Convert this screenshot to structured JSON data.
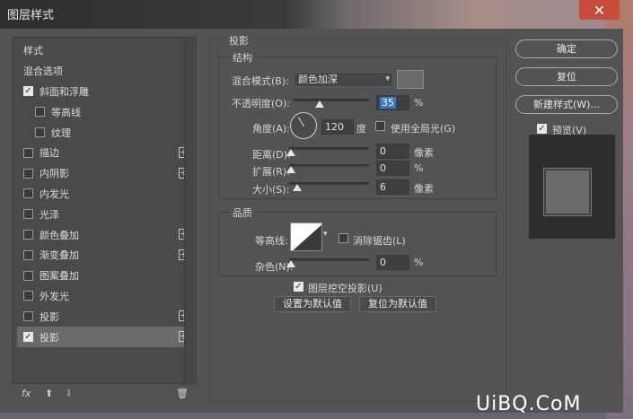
{
  "window": {
    "title": "图层样式"
  },
  "left_panel": {
    "items": [
      {
        "label": "样式",
        "checkbox": false,
        "checked": false,
        "plus": false,
        "sub": false,
        "selected": false
      },
      {
        "label": "混合选项",
        "checkbox": false,
        "checked": false,
        "plus": false,
        "sub": false,
        "selected": false
      },
      {
        "label": "斜面和浮雕",
        "checkbox": true,
        "checked": true,
        "plus": false,
        "sub": false,
        "selected": false
      },
      {
        "label": "等高线",
        "checkbox": true,
        "checked": false,
        "plus": false,
        "sub": true,
        "selected": false
      },
      {
        "label": "纹理",
        "checkbox": true,
        "checked": false,
        "plus": false,
        "sub": true,
        "selected": false
      },
      {
        "label": "描边",
        "checkbox": true,
        "checked": false,
        "plus": true,
        "sub": false,
        "selected": false
      },
      {
        "label": "内阴影",
        "checkbox": true,
        "checked": false,
        "plus": true,
        "sub": false,
        "selected": false
      },
      {
        "label": "内发光",
        "checkbox": true,
        "checked": false,
        "plus": false,
        "sub": false,
        "selected": false
      },
      {
        "label": "光泽",
        "checkbox": true,
        "checked": false,
        "plus": false,
        "sub": false,
        "selected": false
      },
      {
        "label": "颜色叠加",
        "checkbox": true,
        "checked": false,
        "plus": true,
        "sub": false,
        "selected": false
      },
      {
        "label": "渐变叠加",
        "checkbox": true,
        "checked": false,
        "plus": true,
        "sub": false,
        "selected": false
      },
      {
        "label": "图案叠加",
        "checkbox": true,
        "checked": false,
        "plus": false,
        "sub": false,
        "selected": false
      },
      {
        "label": "外发光",
        "checkbox": true,
        "checked": false,
        "plus": false,
        "sub": false,
        "selected": false
      },
      {
        "label": "投影",
        "checkbox": true,
        "checked": false,
        "plus": true,
        "sub": false,
        "selected": false
      },
      {
        "label": "投影",
        "checkbox": true,
        "checked": true,
        "plus": true,
        "sub": false,
        "selected": true
      }
    ],
    "bottom": {
      "fx": "fx",
      "up": "⬆",
      "down": "⬇",
      "trash": "🗑"
    }
  },
  "shadow": {
    "section_title": "投影",
    "structure_title": "结构",
    "blend_mode_label": "混合模式(B):",
    "blend_mode_value": "颜色加深",
    "opacity_label": "不透明度(O):",
    "opacity_value": "35",
    "opacity_unit": "%",
    "opacity_level": 0.35,
    "angle_label": "角度(A):",
    "angle_value": "120",
    "angle_unit": "度",
    "global_light_label": "使用全局光(G)",
    "global_light_checked": false,
    "distance_label": "距离(D):",
    "distance_value": "0",
    "distance_unit": "像素",
    "spread_label": "扩展(R):",
    "spread_value": "0",
    "spread_unit": "%",
    "size_label": "大小(S):",
    "size_value": "6",
    "size_unit": "像素",
    "quality_title": "品质",
    "contour_label": "等高线:",
    "antialias_label": "消除锯齿(L)",
    "antialias_checked": false,
    "noise_label": "杂色(N):",
    "noise_value": "0",
    "noise_unit": "%",
    "knockout_label": "图层挖空投影(U)",
    "knockout_checked": true,
    "set_default_label": "设置为默认值",
    "reset_default_label": "复位为默认值"
  },
  "right": {
    "ok_label": "确定",
    "reset_label": "复位",
    "new_style_label": "新建样式(W)...",
    "preview_label": "预览(V)",
    "preview_checked": true
  },
  "watermark": "UiBQ.CoM",
  "colors": {
    "dialog_bg": "#535353",
    "highlight": "#3a78c8",
    "close": "#c94b3b"
  }
}
